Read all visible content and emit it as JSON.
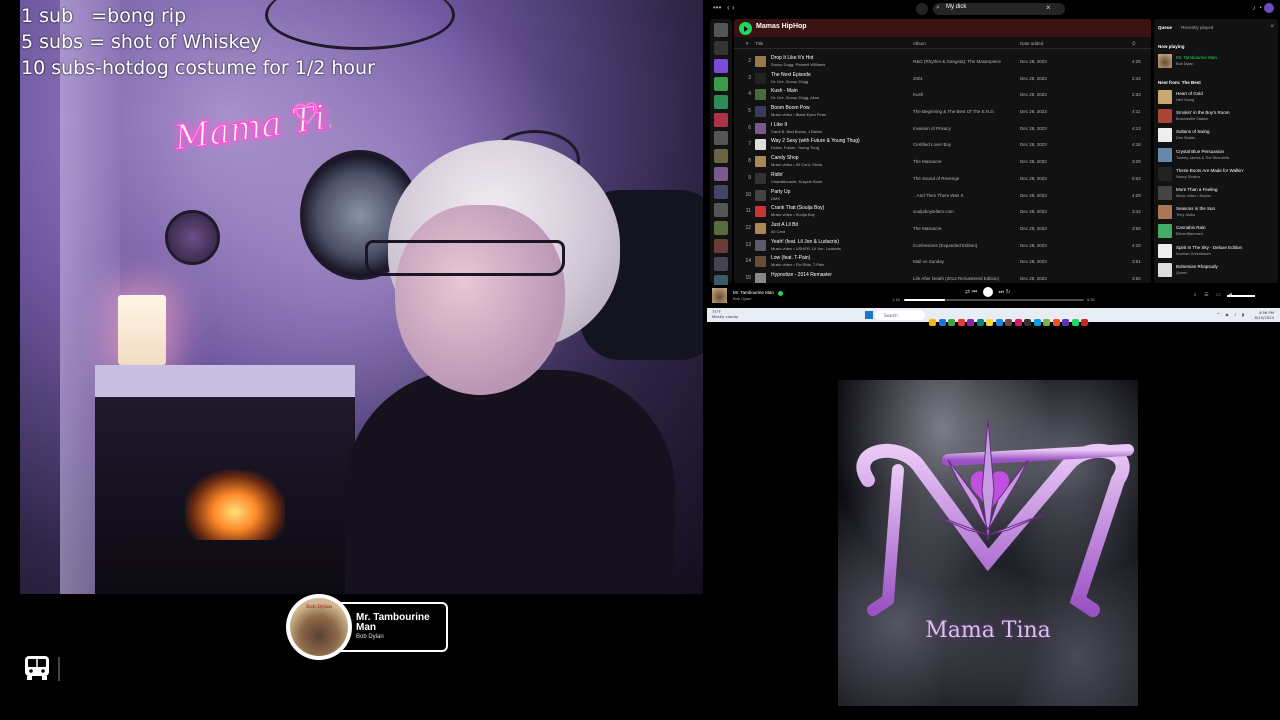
{
  "overlay": {
    "lines": [
      "1 sub   =bong rip",
      "5 subs = shot of Whiskey",
      "10 subs-hotdog costume for 1/2 hour"
    ]
  },
  "now_playing_widget": {
    "title": "Mr. Tambourine Man",
    "artist": "Bob Dylan",
    "album_art_text": "Bob Dylan"
  },
  "spotify": {
    "search_query": "My dick",
    "playlist_title": "Mamas HipHop",
    "columns": {
      "num": "#",
      "title": "Title",
      "album": "Album",
      "date": "Date added",
      "duration": "⏱"
    },
    "tracks": [
      {
        "n": "2",
        "title": "Drop It Like It's Hot",
        "artist": "Snoop Dogg, Pharrell Williams",
        "album": "R&G (Rhythm & Gangsta): The Masterpiece",
        "date": "Dec 28, 2023",
        "duration": "4:26",
        "color": "#9a7a4a"
      },
      {
        "n": "3",
        "title": "The Next Episode",
        "artist": "Dr. Dre, Snoop Dogg",
        "album": "2001",
        "date": "Dec 28, 2023",
        "duration": "2:42",
        "color": "#222222"
      },
      {
        "n": "4",
        "title": "Kush - Main",
        "artist": "Dr. Dre, Snoop Dogg, Akon",
        "album": "Kush",
        "date": "Dec 28, 2023",
        "duration": "2:33",
        "color": "#4a6a3a"
      },
      {
        "n": "5",
        "title": "Boom Boom Pow",
        "artist": "Music video • Black Eyed Peas",
        "album": "The Beginning & The Best Of The E.N.D.",
        "date": "Dec 28, 2023",
        "duration": "4:11",
        "color": "#3a3a5a"
      },
      {
        "n": "6",
        "title": "I Like It",
        "artist": "Cardi B, Bad Bunny, J Balvin",
        "album": "Invasion of Privacy",
        "date": "Dec 28, 2023",
        "duration": "4:13",
        "color": "#7a5a8a"
      },
      {
        "n": "7",
        "title": "Way 2 Sexy (with Future & Young Thug)",
        "artist": "Drake, Future, Young Thug",
        "album": "Certified Lover Boy",
        "date": "Dec 28, 2023",
        "duration": "4:18",
        "color": "#dddddd"
      },
      {
        "n": "8",
        "title": "Candy Shop",
        "artist": "Music video • 50 Cent, Olivia",
        "album": "The Massacre",
        "date": "Dec 28, 2023",
        "duration": "3:29",
        "color": "#aa8855"
      },
      {
        "n": "9",
        "title": "Ridin'",
        "artist": "Chamillionaire, Krayzie Bone",
        "album": "The Sound of Revenge",
        "date": "Dec 28, 2023",
        "duration": "5:03",
        "color": "#333333"
      },
      {
        "n": "10",
        "title": "Party Up",
        "artist": "DMX",
        "album": "...And Then There Was X",
        "date": "Dec 28, 2023",
        "duration": "4:29",
        "color": "#444444"
      },
      {
        "n": "11",
        "title": "Crank That (Soulja Boy)",
        "artist": "Music video • Soulja Boy",
        "album": "souljaboytellem.com",
        "date": "Dec 28, 2023",
        "duration": "3:42",
        "color": "#cc3333"
      },
      {
        "n": "12",
        "title": "Just A Lil Bit",
        "artist": "50 Cent",
        "album": "The Massacre",
        "date": "Dec 28, 2023",
        "duration": "3:58",
        "color": "#aa8855"
      },
      {
        "n": "13",
        "title": "Yeah! (feat. Lil Jon & Ludacris)",
        "artist": "Music video • USHER, Lil Jon, Ludacris",
        "album": "Confessions (Expanded Edition)",
        "date": "Dec 28, 2023",
        "duration": "4:10",
        "color": "#5a5a6a"
      },
      {
        "n": "14",
        "title": "Low (feat. T-Pain)",
        "artist": "Music video • Flo Rida, T-Pain",
        "album": "Mail on Sunday",
        "date": "Dec 28, 2023",
        "duration": "3:51",
        "color": "#6a4a3a"
      },
      {
        "n": "15",
        "title": "Hypnotize - 2014 Remaster",
        "artist": "",
        "album": "Life After Death (2014 Remastered Edition)",
        "date": "Dec 28, 2023",
        "duration": "3:50",
        "color": "#888888"
      }
    ],
    "queue": {
      "tab_queue": "Queue",
      "tab_recent": "Recently played",
      "now_playing_label": "Now playing",
      "now_playing": {
        "title": "Mr. Tambourine Man",
        "artist": "Bob Dylan"
      },
      "next_from_label": "Next from: The Best",
      "items": [
        {
          "title": "Heart of Gold",
          "artist": "Neil Young",
          "color": "#c8a870"
        },
        {
          "title": "Smokin' in the Boy's Room",
          "artist": "Brownsville Station",
          "color": "#aa4433"
        },
        {
          "title": "Sultans of Swing",
          "artist": "Dire Straits",
          "color": "#eeeeee"
        },
        {
          "title": "Crystal Blue Persuasion",
          "artist": "Tommy James & The Shondells",
          "color": "#6688aa"
        },
        {
          "title": "These Boots Are Made for Walkin'",
          "artist": "Nancy Sinatra",
          "color": "#222222"
        },
        {
          "title": "More Than a Feeling",
          "artist": "Music video • Boston",
          "color": "#444444"
        },
        {
          "title": "Seasons in the Sun",
          "artist": "Terry Jacks",
          "color": "#aa7755"
        },
        {
          "title": "Cannabis Rain",
          "artist": "ElevenBaremen",
          "color": "#44aa66"
        },
        {
          "title": "Spirit In The Sky - Deluxe Edition",
          "artist": "Norman Greenbaum",
          "color": "#eeeeee"
        },
        {
          "title": "Bohemian Rhapsody",
          "artist": "Queen",
          "color": "#dddddd"
        }
      ]
    },
    "player": {
      "title": "Mr. Tambourine Man",
      "artist": "Bob Dylan",
      "elapsed": "1:15",
      "total": "5:30",
      "progress": 0.23
    }
  },
  "taskbar": {
    "weather_temp": "75°F",
    "weather_desc": "Mostly cloudy",
    "search_placeholder": "Search",
    "time": "4:56 PM",
    "date": "8/15/2024"
  },
  "logo": {
    "text": "Mama Tina"
  },
  "neon_sign": {
    "text": "Mama Tina"
  }
}
